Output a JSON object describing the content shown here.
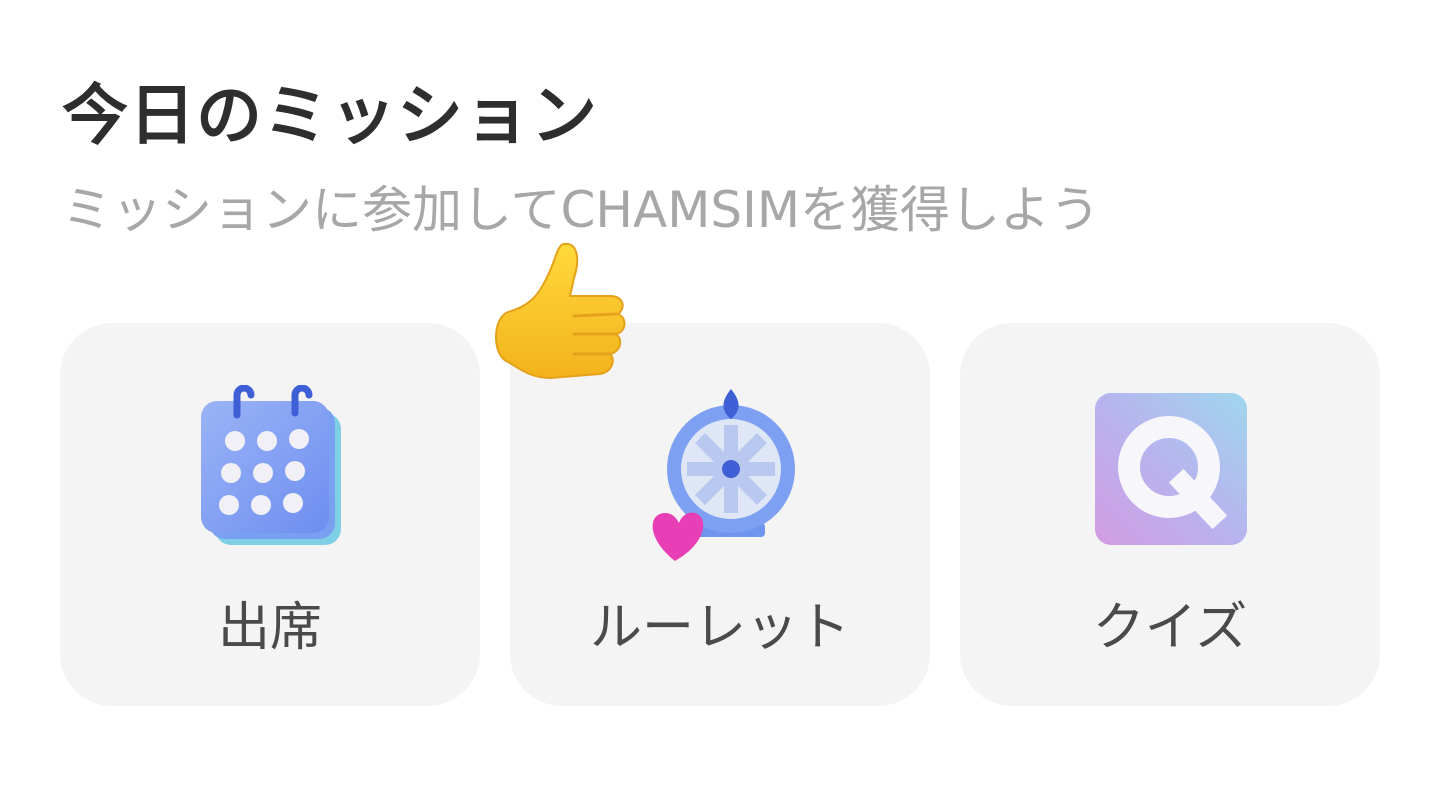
{
  "header": {
    "title": "今日のミッション",
    "subtitle": "ミッションに参加してCHAMSIMを獲得しよう"
  },
  "missions": [
    {
      "label": "出席",
      "icon": "calendar-icon"
    },
    {
      "label": "ルーレット",
      "icon": "roulette-wheel-icon"
    },
    {
      "label": "クイズ",
      "icon": "quiz-q-icon"
    }
  ],
  "decoration": {
    "icon": "thumbs-up-icon"
  },
  "colors": {
    "title": "#2e2e2e",
    "subtitle": "#a7a7a7",
    "card_background": "#f4f4f4",
    "label": "#4a4a4a",
    "accent_blue": "#6b8cf0",
    "heart_pink": "#e93fb6"
  }
}
